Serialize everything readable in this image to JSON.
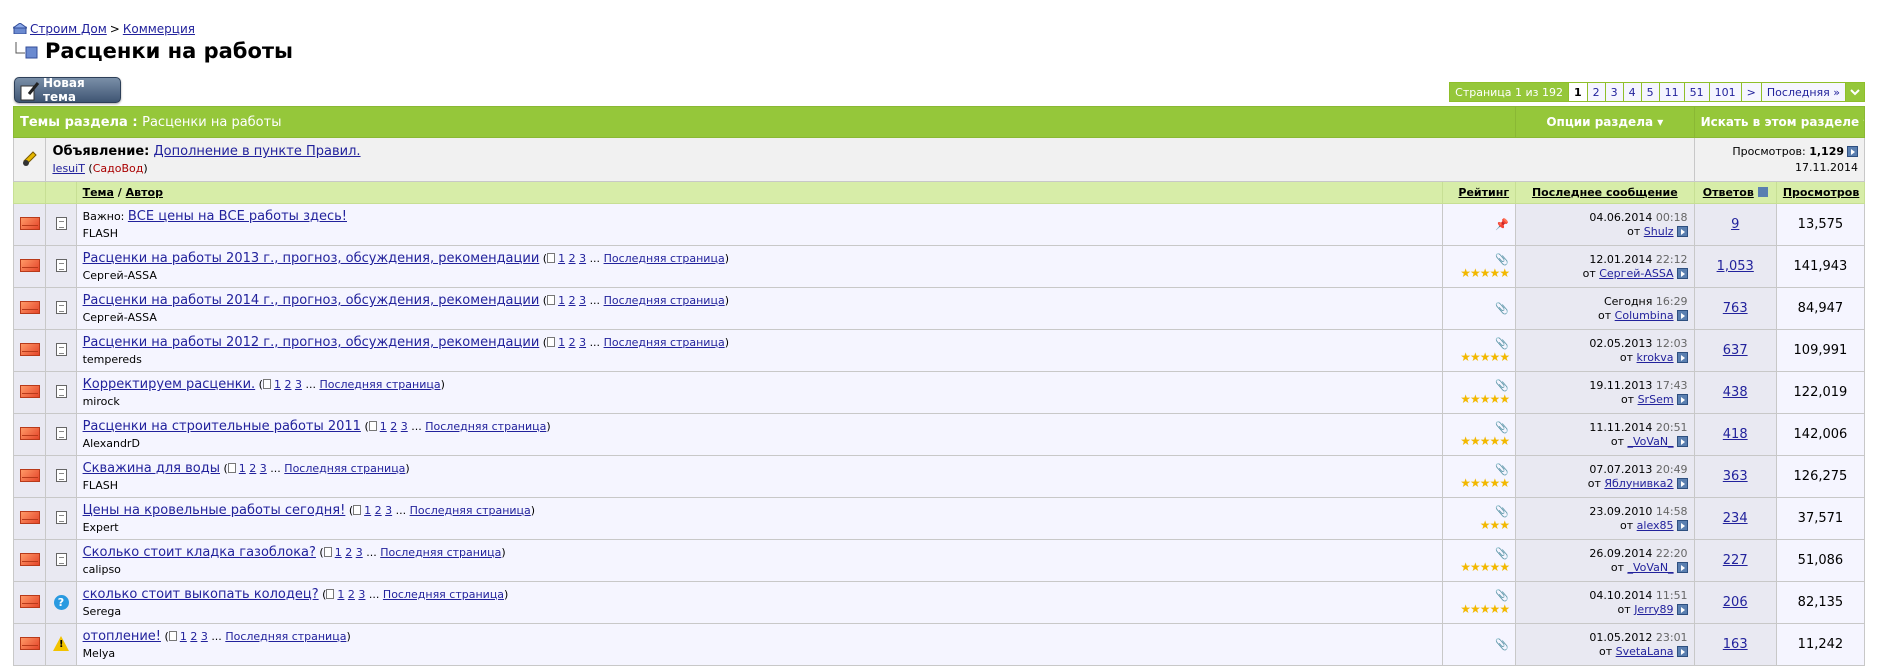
{
  "breadcrumb": {
    "home": "Строим Дом",
    "sep": ">",
    "section": "Коммерция"
  },
  "page_title": "Расценки на работы",
  "new_topic_label": "Новая тема",
  "pager": {
    "label": "Страница 1 из 192",
    "current": "1",
    "pages": [
      "2",
      "3",
      "4",
      "5",
      "11",
      "51",
      "101"
    ],
    "next": ">",
    "last": "Последняя »"
  },
  "section_header": {
    "title": "Темы раздела",
    "colon": ":",
    "forum": "Расценки на работы",
    "options": "Опции раздела",
    "search": "Искать в этом разделе"
  },
  "announcement": {
    "prefix": "Объявление:",
    "title": "Дополнение в пункте Правил.",
    "author": "IesuiT",
    "group": "СадоВод",
    "views_label": "Просмотров:",
    "views": "1,129",
    "date": "17.11.2014"
  },
  "columns": {
    "topic": "Тема",
    "slash": "/",
    "author": "Автор",
    "rating": "Рейтинг",
    "last_post": "Последнее сообщение",
    "replies": "Ответов",
    "views": "Просмотров"
  },
  "common": {
    "by": "от",
    "last_page": "Последняя страница",
    "ellipsis": "...",
    "p1": "1",
    "p2": "2",
    "p3": "3"
  },
  "topics": [
    {
      "prefix": "Важно:",
      "title": "ВСЕ цены на ВСЕ работы здесь!",
      "author": "FLASH",
      "date": "04.06.2014",
      "time": "00:18",
      "last_by": "Shulz",
      "replies": "9",
      "views": "13,575",
      "stars": ""
    },
    {
      "prefix": "",
      "title": "Расценки на работы 2013 г., прогноз, обсуждения, рекомендации",
      "author": "Сергей-ASSA",
      "date": "12.01.2014",
      "time": "22:12",
      "last_by": "Сергей-ASSA",
      "replies": "1,053",
      "views": "141,943",
      "stars": "★★★★★"
    },
    {
      "prefix": "",
      "title": "Расценки на работы 2014 г., прогноз, обсуждения, рекомендации",
      "author": "Сергей-ASSA",
      "date": "Сегодня",
      "time": "16:29",
      "last_by": "Columbina",
      "replies": "763",
      "views": "84,947",
      "stars": ""
    },
    {
      "prefix": "",
      "title": "Расценки на работы 2012 г., прогноз, обсуждения, рекомендации",
      "author": "tempereds",
      "date": "02.05.2013",
      "time": "12:03",
      "last_by": "krokva",
      "replies": "637",
      "views": "109,991",
      "stars": "★★★★★"
    },
    {
      "prefix": "",
      "title": "Корректируем расценки.",
      "author": "mirock",
      "date": "19.11.2013",
      "time": "17:43",
      "last_by": "SrSem",
      "replies": "438",
      "views": "122,019",
      "stars": "★★★★★"
    },
    {
      "prefix": "",
      "title": "Расценки на строительные работы 2011",
      "author": "AlexandrD",
      "date": "11.11.2014",
      "time": "20:51",
      "last_by": "_VoVaN_",
      "replies": "418",
      "views": "142,006",
      "stars": "★★★★★"
    },
    {
      "prefix": "",
      "title": "Скважина для воды",
      "author": "FLASH",
      "date": "07.07.2013",
      "time": "20:49",
      "last_by": "Яблунивка2",
      "replies": "363",
      "views": "126,275",
      "stars": "★★★★★"
    },
    {
      "prefix": "",
      "title": "Цены на кровельные работы сегодня!",
      "author": "Expert",
      "date": "23.09.2010",
      "time": "14:58",
      "last_by": "alex85",
      "replies": "234",
      "views": "37,571",
      "stars": "★★★"
    },
    {
      "prefix": "",
      "title": "Сколько стоит кладка газоблока?",
      "author": "calipso",
      "date": "26.09.2014",
      "time": "22:20",
      "last_by": "_VoVaN_",
      "replies": "227",
      "views": "51,086",
      "stars": "★★★★★"
    },
    {
      "prefix": "",
      "title": "сколько стоит выкопать колодец?",
      "author": "Serega",
      "date": "04.10.2014",
      "time": "11:51",
      "last_by": "Jerry89",
      "replies": "206",
      "views": "82,135",
      "stars": "★★★★★"
    },
    {
      "prefix": "",
      "title": "отопление!",
      "author": "Melya",
      "date": "01.05.2012",
      "time": "23:01",
      "last_by": "SvetaLana",
      "replies": "163",
      "views": "11,242",
      "stars": ""
    }
  ]
}
